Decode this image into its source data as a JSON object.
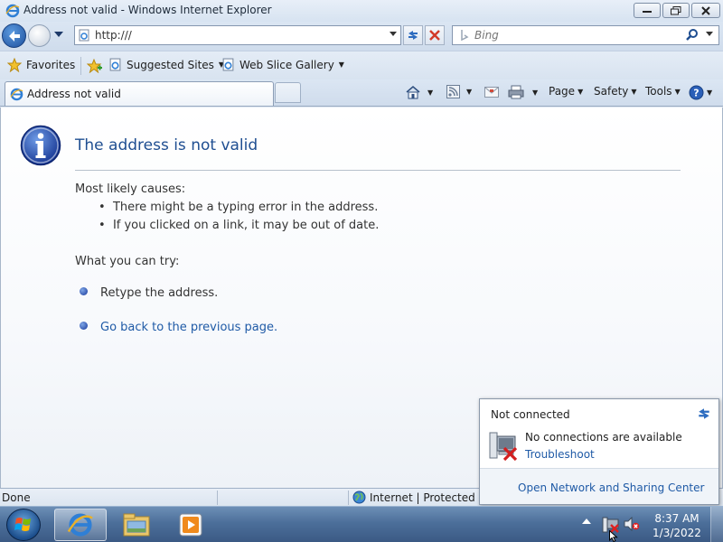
{
  "window": {
    "title": "Address not valid - Windows Internet Explorer"
  },
  "address_bar": {
    "url": "http:///"
  },
  "search": {
    "placeholder": "Bing"
  },
  "favorites_bar": {
    "favorites_label": "Favorites",
    "items": [
      {
        "label": "Suggested Sites"
      },
      {
        "label": "Web Slice Gallery"
      }
    ]
  },
  "tabs": [
    {
      "label": "Address not valid",
      "active": true
    }
  ],
  "command_bar": {
    "page_label": "Page",
    "safety_label": "Safety",
    "tools_label": "Tools"
  },
  "error_page": {
    "heading": "The address is not valid",
    "causes_heading": "Most likely causes:",
    "causes": [
      "There might be a typing error in the address.",
      "If you clicked on a link, it may be out of date."
    ],
    "try_heading": "What you can try:",
    "try_items": [
      {
        "text": "Retype the address.",
        "link": false
      },
      {
        "text": "Go back to the previous page.",
        "link": true
      }
    ]
  },
  "status_bar": {
    "status": "Done",
    "zone": "Internet | Protected Mo"
  },
  "network_popup": {
    "title": "Not connected",
    "message": "No connections are available",
    "troubleshoot_link": "Troubleshoot",
    "footer_link": "Open Network and Sharing Center"
  },
  "taskbar": {
    "time": "8:37 AM",
    "date": "1/3/2022",
    "pinned": [
      "internet-explorer-icon",
      "windows-explorer-icon",
      "media-player-icon"
    ]
  },
  "colors": {
    "heading_blue": "#1f4e91",
    "link_blue": "#1f5aa6",
    "taskbar": "#4c6f9a"
  }
}
